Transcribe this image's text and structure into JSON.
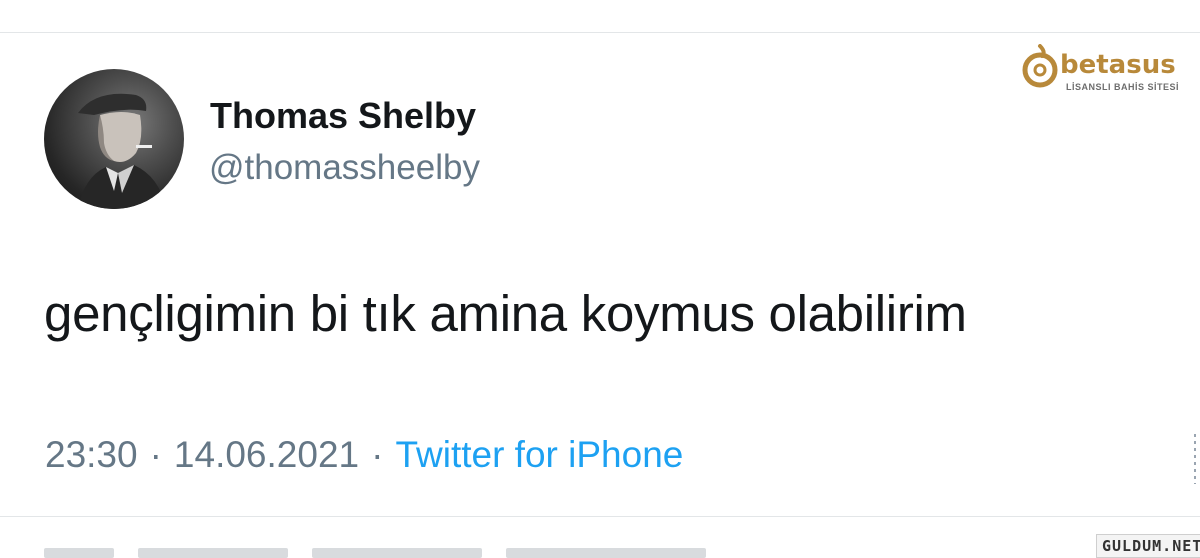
{
  "tweet": {
    "author_name": "Thomas Shelby",
    "author_handle": "@thomassheelby",
    "text": "gençligimin bi tık amina koymus olabilirim",
    "time": "23:30",
    "date": "14.06.2021",
    "separator": "·",
    "source": "Twitter for iPhone"
  },
  "overlay_logo": {
    "brand": "betasus",
    "tagline": "LİSANSLI BAHİS SİTESİ",
    "color": "#b8893a"
  },
  "watermark": {
    "text": "GULDUM.NET"
  },
  "colors": {
    "text_primary": "#14171a",
    "text_secondary": "#657786",
    "link": "#1da1f2",
    "divider": "#e3e6e8"
  }
}
